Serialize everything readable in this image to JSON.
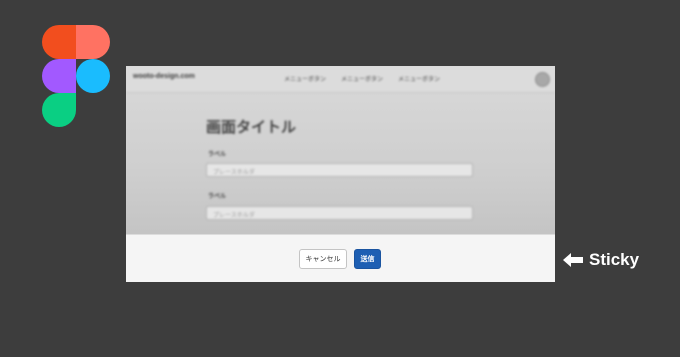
{
  "branding": {
    "logo_icon": "figma-logo-icon",
    "colors": {
      "red": "#f24e1e",
      "salmon": "#ff7262",
      "purple": "#a259ff",
      "blue": "#1abcfe",
      "green": "#0acf83"
    }
  },
  "mockup": {
    "header": {
      "site_name": "wooto-design.com",
      "menu": [
        "メニューボタン",
        "メニューボタン",
        "メニューボタン"
      ],
      "avatar_icon": "avatar-icon"
    },
    "form": {
      "title": "画面タイトル",
      "fields": [
        {
          "label": "ラベル",
          "placeholder": "プレースホルダ"
        },
        {
          "label": "ラベル",
          "placeholder": "プレースホルダ"
        }
      ]
    },
    "sticky_footer": {
      "cancel_label": "キャンセル",
      "submit_label": "送信",
      "submit_color": "#1e5fb3"
    }
  },
  "annotation": {
    "arrow_icon": "arrow-left-icon",
    "label": "Sticky"
  }
}
